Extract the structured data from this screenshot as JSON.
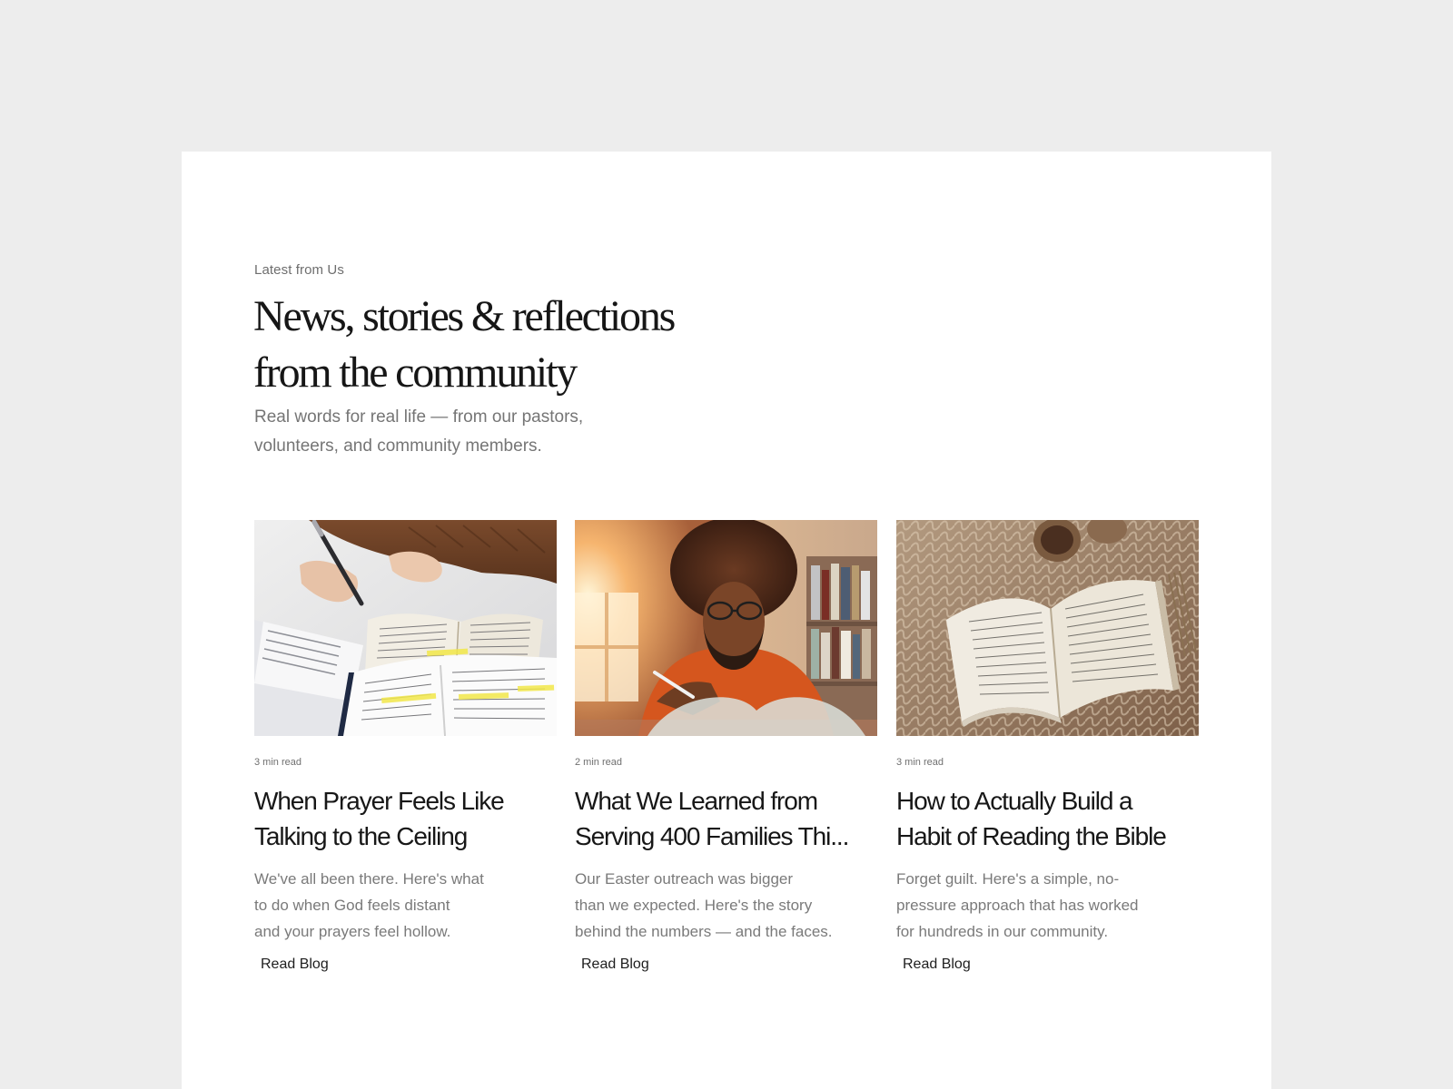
{
  "section": {
    "eyebrow": "Latest from Us",
    "heading_lines": [
      "News, stories & reflections",
      "from the community"
    ],
    "subtext_lines": [
      "Real words for real life — from our pastors,",
      "volunteers, and community members."
    ]
  },
  "posts": [
    {
      "image": "writing-notes-bible-photo",
      "read_time": "3 min read",
      "title_lines": [
        "When Prayer Feels Like",
        "Talking to the Ceiling"
      ],
      "excerpt_lines": [
        "We've all been there. Here's what",
        "to do when God feels distant",
        "and your prayers feel hollow."
      ],
      "cta": "Read Blog"
    },
    {
      "image": "man-studying-window-photo",
      "read_time": "2 min read",
      "title_lines": [
        "What We Learned from",
        "Serving 400 Families Thi..."
      ],
      "excerpt_lines": [
        "Our Easter outreach was bigger",
        "than we expected. Here's the story",
        "behind the numbers — and the faces."
      ],
      "cta": "Read Blog"
    },
    {
      "image": "open-book-knit-blanket-photo",
      "read_time": "3 min read",
      "title_lines": [
        "How to Actually Build a",
        "Habit of Reading the Bible"
      ],
      "excerpt_lines": [
        "Forget guilt. Here's a simple, no-",
        "pressure approach that has worked",
        "for hundreds in our community."
      ],
      "cta": "Read Blog"
    }
  ],
  "colors": {
    "page_background": "#ededed",
    "panel_background": "#ffffff",
    "heading": "#161616",
    "muted_text": "#757575"
  }
}
